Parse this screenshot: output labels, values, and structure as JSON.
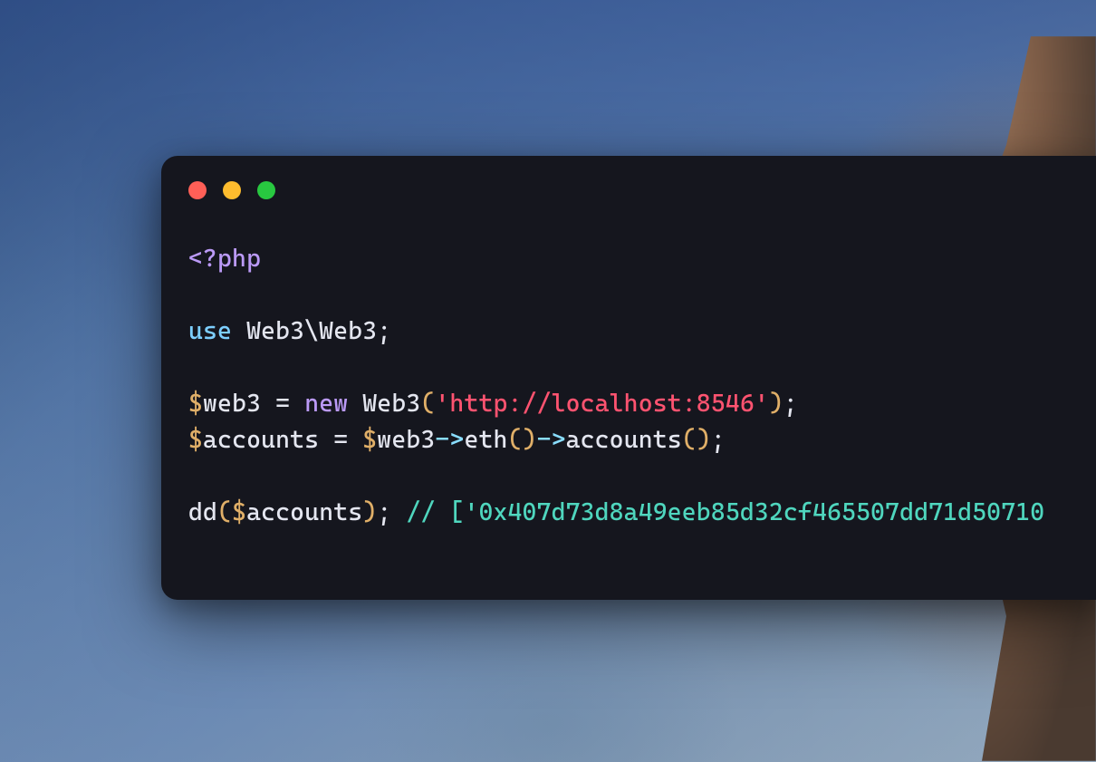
{
  "window": {
    "traffic": {
      "red": "close",
      "yellow": "minimize",
      "green": "zoom"
    }
  },
  "code": {
    "line1": {
      "php_open": "<?php"
    },
    "line3": {
      "use": "use",
      "ns": " Web3\\Web3;"
    },
    "line5": {
      "sigil1": "$",
      "var1": "web3",
      "eq": " = ",
      "new": "new",
      "sp": " ",
      "class": "Web3",
      "lp": "(",
      "str": "'http://localhost:8546'",
      "rp": ")",
      "semi": ";"
    },
    "line6": {
      "sigil1": "$",
      "var1": "accounts",
      "eq": " = ",
      "sigil2": "$",
      "var2": "web3",
      "arrow1": "->",
      "m1": "eth",
      "lp1": "(",
      "rp1": ")",
      "arrow2": "->",
      "m2": "accounts",
      "lp2": "(",
      "rp2": ")",
      "semi": ";"
    },
    "line8": {
      "func": "dd",
      "lp": "(",
      "sigil": "$",
      "var": "accounts",
      "rp": ")",
      "semi": ";",
      "sp": " ",
      "comment": "// ['0x407d73d8a49eeb85d32cf465507dd71d50710"
    }
  }
}
